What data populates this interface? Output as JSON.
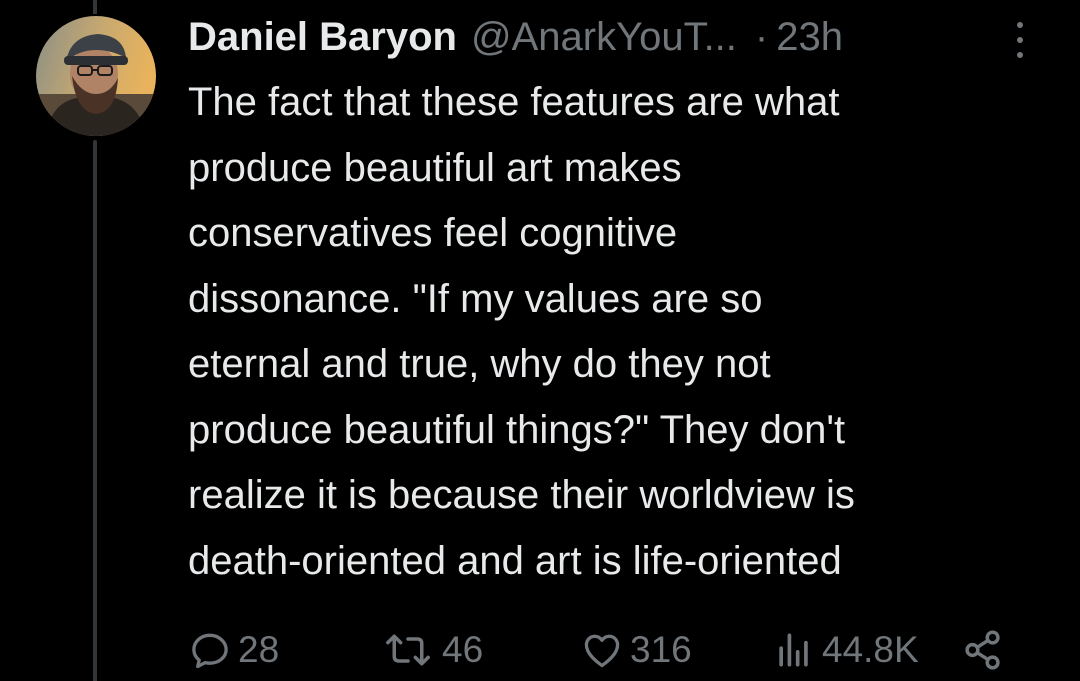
{
  "author": {
    "display_name": "Daniel Baryon",
    "handle": "@AnarkYouT...",
    "separator": "·",
    "time": "23h",
    "avatar_icon": "user-avatar-photo"
  },
  "tweet": {
    "text": "The fact that these features are what\nproduce beautiful art makes\nconservatives feel cognitive\ndissonance. \"If my values are so\neternal and true, why do they not\nproduce beautiful things?\" They don't\nrealize it is because their worldview is\ndeath-oriented and art is life-oriented"
  },
  "actions": {
    "replies": "28",
    "retweets": "46",
    "likes": "316",
    "views": "44.8K"
  },
  "colors": {
    "background": "#000000",
    "text_primary": "#e7e9ea",
    "text_secondary": "#71767b",
    "thread_line": "#333639"
  },
  "icons": [
    "reply-icon",
    "retweet-icon",
    "like-icon",
    "views-icon",
    "share-icon",
    "more-options-icon"
  ]
}
